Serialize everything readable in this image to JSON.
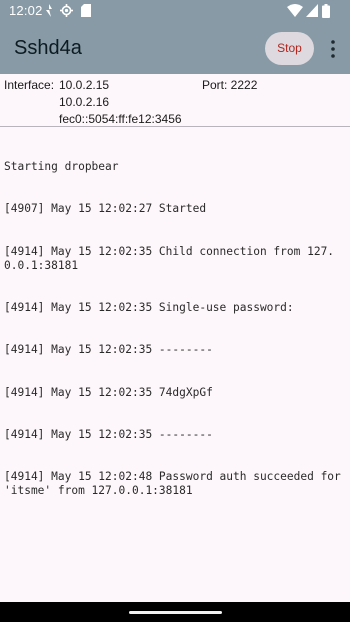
{
  "status_bar": {
    "time": "12:02",
    "icons": [
      "notification-icon",
      "settings-gear-icon",
      "sd-card-icon",
      "wifi-icon",
      "signal-icon",
      "battery-icon"
    ]
  },
  "app_bar": {
    "title": "Sshd4a",
    "stop_label": "Stop",
    "menu_icon": "more-vert-icon"
  },
  "info": {
    "interface_label": "Interface:",
    "addresses": [
      "10.0.2.15",
      "10.0.2.16",
      "fec0::5054:ff:fe12:3456"
    ],
    "port_text": "Port: 2222"
  },
  "log": [
    "Starting dropbear",
    "[4907] May 15 12:02:27 Started",
    "[4914] May 15 12:02:35 Child connection from 127.0.0.1:38181",
    "[4914] May 15 12:02:35 Single-use password:",
    "[4914] May 15 12:02:35 --------",
    "[4914] May 15 12:02:35 74dgXpGf",
    "[4914] May 15 12:02:35 --------",
    "[4914] May 15 12:02:48 Password auth succeeded for 'itsme' from 127.0.0.1:38181"
  ],
  "colors": {
    "app_bar": "#879aa5",
    "stop_text": "#b3261e",
    "background": "#fdf7fb"
  }
}
